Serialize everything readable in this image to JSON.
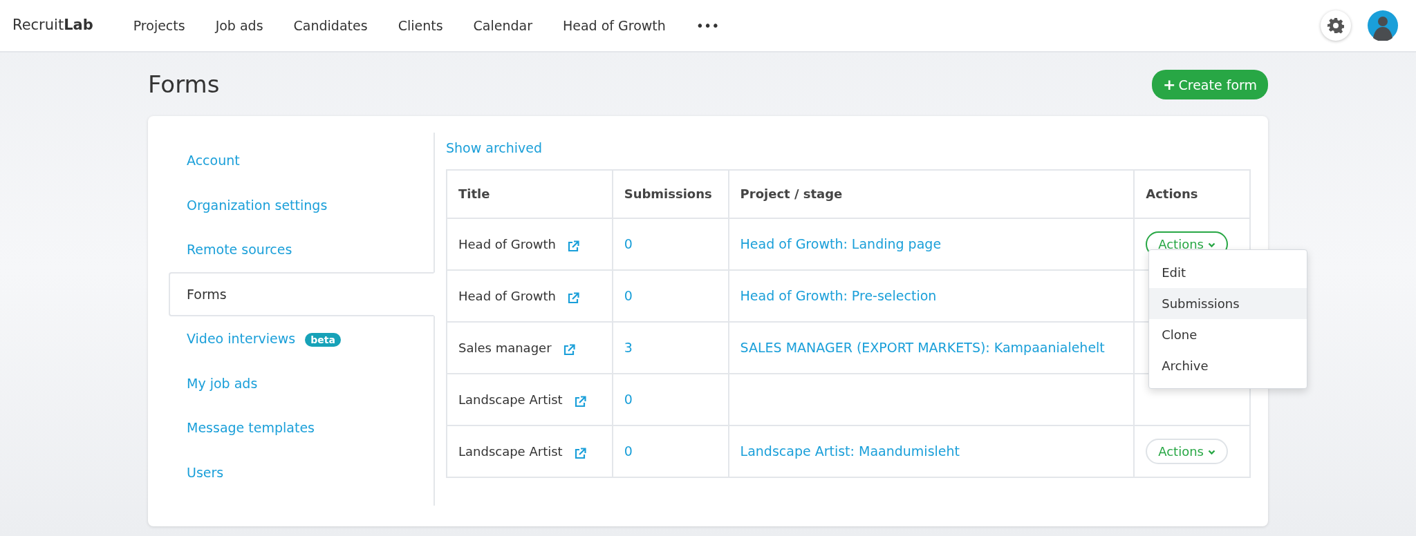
{
  "navbar": {
    "brand_light": "Recruit",
    "brand_bold": "Lab",
    "items": [
      {
        "label": "Projects"
      },
      {
        "label": "Job ads"
      },
      {
        "label": "Candidates"
      },
      {
        "label": "Clients"
      },
      {
        "label": "Calendar"
      },
      {
        "label": "Head of Growth"
      },
      {
        "label": "•••"
      }
    ]
  },
  "page": {
    "title": "Forms",
    "create_button": "Create form",
    "create_icon": "+"
  },
  "sidebar": {
    "items": [
      {
        "label": "Account",
        "selected": false
      },
      {
        "label": "Organization settings",
        "selected": false
      },
      {
        "label": "Remote sources",
        "selected": false
      },
      {
        "label": "Forms",
        "selected": true
      },
      {
        "label": "Video interviews",
        "selected": false,
        "badge": "beta"
      },
      {
        "label": "My job ads",
        "selected": false
      },
      {
        "label": "Message templates",
        "selected": false
      },
      {
        "label": "Users",
        "selected": false
      }
    ]
  },
  "show_archived": "Show archived",
  "table": {
    "columns": [
      "Title",
      "Submissions",
      "Project / stage",
      "Actions"
    ],
    "rows": [
      {
        "title": "Head of Growth",
        "submissions": "0",
        "project": "Head of Growth: Landing page",
        "action": "Actions",
        "action_active": true
      },
      {
        "title": "Head of Growth",
        "submissions": "0",
        "project": "Head of Growth: Pre-selection"
      },
      {
        "title": "Sales manager",
        "submissions": "3",
        "project": "SALES MANAGER (EXPORT MARKETS): Kampaanialehelt"
      },
      {
        "title": "Landscape Artist",
        "submissions": "0"
      },
      {
        "title": "Landscape Artist",
        "submissions": "0",
        "project": "Landscape Artist: Maandumisleht",
        "action": "Actions",
        "action_active": false
      }
    ]
  },
  "dropdown": {
    "items": [
      {
        "label": "Edit",
        "selected": false
      },
      {
        "label": "Submissions",
        "selected": true
      },
      {
        "label": "Clone",
        "selected": false
      },
      {
        "label": "Archive",
        "selected": false
      }
    ]
  }
}
